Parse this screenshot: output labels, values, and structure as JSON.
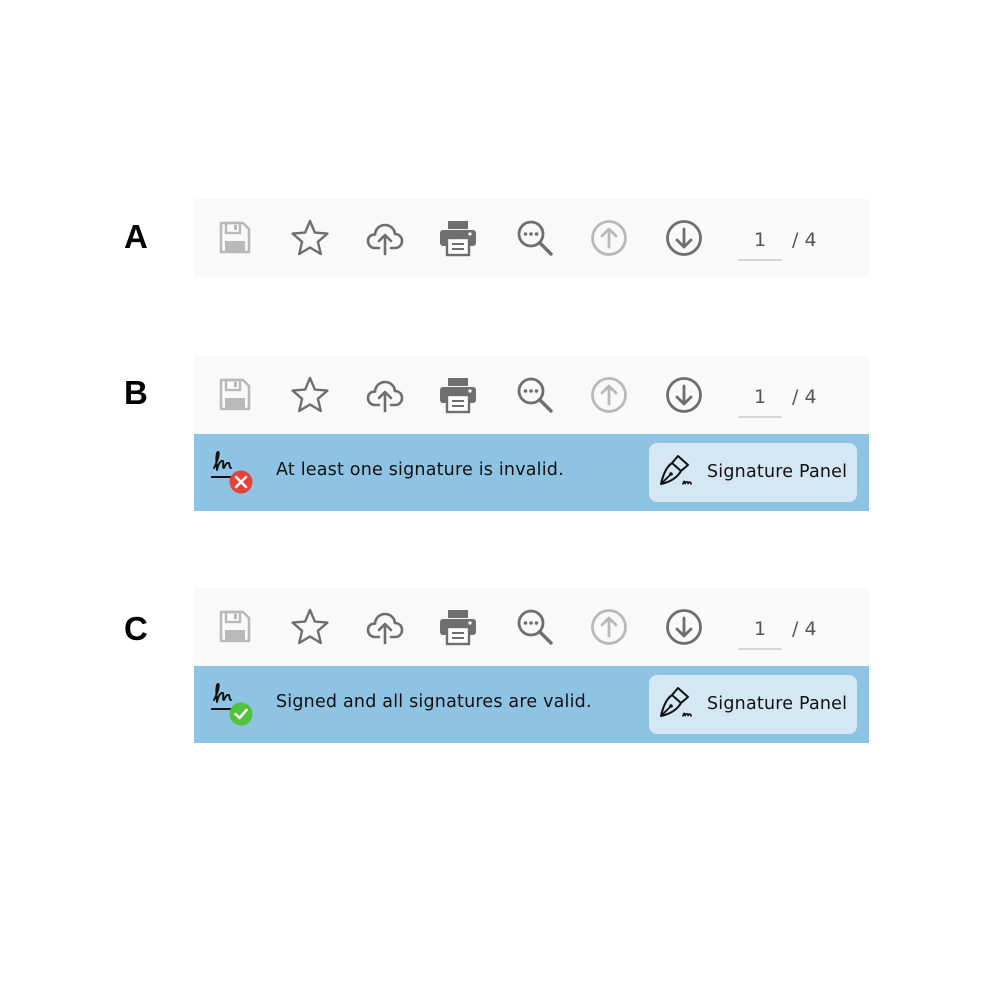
{
  "sections": [
    {
      "label": "A",
      "page": {
        "current": "1",
        "separator": "/ 4"
      }
    },
    {
      "label": "B",
      "page": {
        "current": "1",
        "separator": "/ 4"
      },
      "banner": {
        "status": "invalid",
        "message": "At least one signature is invalid.",
        "button_label": "Signature Panel"
      }
    },
    {
      "label": "C",
      "page": {
        "current": "1",
        "separator": "/ 4"
      },
      "banner": {
        "status": "valid",
        "message": "Signed and all signatures are valid.",
        "button_label": "Signature Panel"
      }
    }
  ],
  "toolbar_icons": [
    "save-icon",
    "star-icon",
    "cloud-upload-icon",
    "print-icon",
    "search-icon",
    "arrow-up-circle-icon",
    "arrow-down-circle-icon"
  ],
  "colors": {
    "toolbar_bg": "#f9f9f9",
    "icon": "#6e6e6e",
    "icon_disabled": "#b9b9b9",
    "banner_bg": "#8fc3e3",
    "panel_button_bg": "#d3e7f4",
    "invalid_badge": "#e8403a",
    "valid_badge": "#52c23a"
  }
}
